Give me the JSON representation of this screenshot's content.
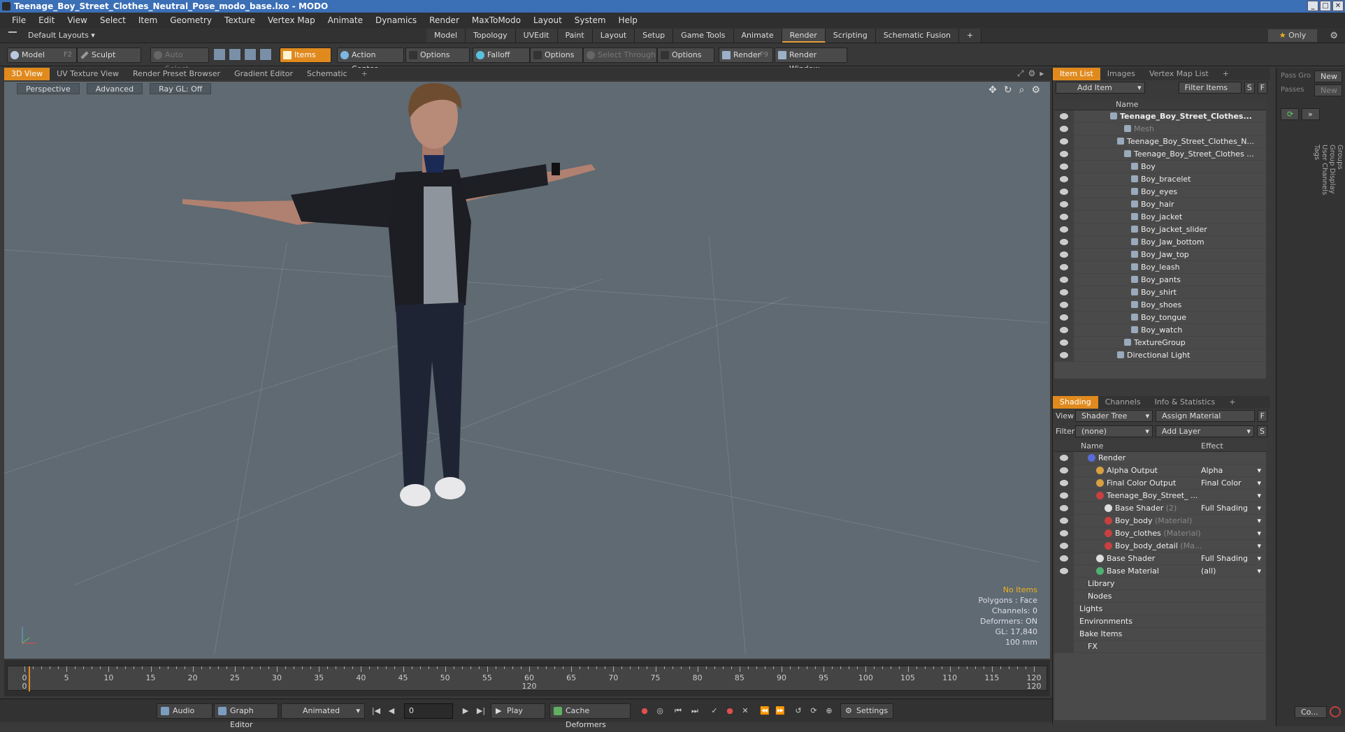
{
  "app": {
    "title": "Teenage_Boy_Street_Clothes_Neutral_Pose_modo_base.lxo - MODO"
  },
  "menu": [
    "File",
    "Edit",
    "View",
    "Select",
    "Item",
    "Geometry",
    "Texture",
    "Vertex Map",
    "Animate",
    "Dynamics",
    "Render",
    "MaxToModo",
    "Layout",
    "System",
    "Help"
  ],
  "layout": {
    "default_layouts": "Default Layouts ▾",
    "tabs": [
      "Model",
      "Topology",
      "UVEdit",
      "Paint",
      "Layout",
      "Setup",
      "Game Tools",
      "Animate",
      "Render",
      "Scripting",
      "Schematic Fusion",
      "+"
    ],
    "active_tab": "Render",
    "only": "Only"
  },
  "toolbar": {
    "model": "Model",
    "model_key": "F2",
    "sculpt": "Sculpt",
    "auto_select": "Auto Select",
    "items": "Items",
    "action_center": "Action Center",
    "options1": "Options",
    "falloff": "Falloff",
    "options2": "Options",
    "select_through": "Select Through",
    "options3": "Options",
    "render": "Render",
    "render_key": "F9",
    "render_window": "Render Window"
  },
  "viewport_tabs": [
    "3D View",
    "UV Texture View",
    "Render Preset Browser",
    "Gradient Editor",
    "Schematic",
    "+"
  ],
  "viewport": {
    "perspective": "Perspective",
    "advanced": "Advanced",
    "ray_gl": "Ray GL: Off",
    "info": {
      "no_items": "No Items",
      "polygons": "Polygons : Face",
      "channels": "Channels: 0",
      "deformers": "Deformers: ON",
      "gl": "GL: 17,840",
      "scale": "100 mm"
    }
  },
  "timeline": {
    "ticks": [
      "0",
      "5",
      "10",
      "15",
      "20",
      "25",
      "30",
      "35",
      "40",
      "45",
      "50",
      "55",
      "60",
      "65",
      "70",
      "75",
      "80",
      "85",
      "90",
      "95",
      "100",
      "105",
      "110",
      "115",
      "120"
    ],
    "start": "0",
    "mid": "120",
    "end": "120"
  },
  "bottombar": {
    "audio": "Audio",
    "graph_editor": "Graph Editor",
    "animated": "Animated",
    "frame": "0",
    "play": "Play",
    "cache_deformers": "Cache Deformers",
    "settings": "Settings"
  },
  "item_list": {
    "tabs": [
      "Item List",
      "Images",
      "Vertex Map List",
      "+"
    ],
    "add_item": "Add Item",
    "filter_items": "Filter Items",
    "s": "S",
    "f": "F",
    "col_name": "Name",
    "rows": [
      {
        "label": "Teenage_Boy_Street_Clothes...",
        "indent": 1,
        "bold": true
      },
      {
        "label": "Mesh",
        "indent": 3,
        "dim": true
      },
      {
        "label": "Teenage_Boy_Street_Clothes_N...",
        "indent": 2
      },
      {
        "label": "Teenage_Boy_Street_Clothes ...",
        "indent": 3
      },
      {
        "label": "Boy",
        "indent": 4
      },
      {
        "label": "Boy_bracelet",
        "indent": 4
      },
      {
        "label": "Boy_eyes",
        "indent": 4
      },
      {
        "label": "Boy_hair",
        "indent": 4
      },
      {
        "label": "Boy_jacket",
        "indent": 4
      },
      {
        "label": "Boy_jacket_slider",
        "indent": 4
      },
      {
        "label": "Boy_Jaw_bottom",
        "indent": 4
      },
      {
        "label": "Boy_Jaw_top",
        "indent": 4
      },
      {
        "label": "Boy_leash",
        "indent": 4
      },
      {
        "label": "Boy_pants",
        "indent": 4
      },
      {
        "label": "Boy_shirt",
        "indent": 4
      },
      {
        "label": "Boy_shoes",
        "indent": 4
      },
      {
        "label": "Boy_tongue",
        "indent": 4
      },
      {
        "label": "Boy_watch",
        "indent": 4
      },
      {
        "label": "TextureGroup",
        "indent": 3
      },
      {
        "label": "Directional Light",
        "indent": 2
      }
    ]
  },
  "shading": {
    "tabs": [
      "Shading",
      "Channels",
      "Info & Statistics",
      "+"
    ],
    "view_label": "View",
    "view_value": "Shader Tree",
    "assign_material": "Assign Material",
    "filter_label": "Filter",
    "filter_value": "(none)",
    "add_layer": "Add Layer",
    "f": "F",
    "s": "S",
    "col_name": "Name",
    "col_effect": "Effect",
    "rows": [
      {
        "label": "Render",
        "indent": 1,
        "color": "#5a6ad8",
        "effect": ""
      },
      {
        "label": "Alpha Output",
        "indent": 2,
        "color": "#d8a040",
        "effect": "Alpha"
      },
      {
        "label": "Final Color Output",
        "indent": 2,
        "color": "#d8a040",
        "effect": "Final Color"
      },
      {
        "label": "Teenage_Boy_Street_ ...",
        "indent": 2,
        "color": "#c84040",
        "effect": " "
      },
      {
        "label": "Base Shader",
        "suffix": "(2)",
        "indent": 3,
        "color": "#dddddd",
        "effect": "Full Shading"
      },
      {
        "label": "Boy_body",
        "suffix": "(Material)",
        "indent": 3,
        "color": "#c84040",
        "effect": " "
      },
      {
        "label": "Boy_clothes",
        "suffix": "(Material)",
        "indent": 3,
        "color": "#c84040",
        "effect": " "
      },
      {
        "label": "Boy_body_detail",
        "suffix": "(Ma...",
        "indent": 3,
        "color": "#c84040",
        "effect": " "
      },
      {
        "label": "Base Shader",
        "indent": 2,
        "color": "#dddddd",
        "effect": "Full Shading"
      },
      {
        "label": "Base Material",
        "indent": 2,
        "color": "#50b070",
        "effect": "(all)"
      },
      {
        "label": "Library",
        "indent": 1,
        "color": "",
        "effect": ""
      },
      {
        "label": "Nodes",
        "indent": 1,
        "color": "",
        "effect": ""
      },
      {
        "label": "Lights",
        "indent": 0,
        "color": "",
        "effect": ""
      },
      {
        "label": "Environments",
        "indent": 0,
        "color": "",
        "effect": ""
      },
      {
        "label": "Bake Items",
        "indent": 0,
        "color": "",
        "effect": ""
      },
      {
        "label": "FX",
        "indent": 1,
        "color": "",
        "effect": ""
      }
    ]
  },
  "far_right": {
    "pass_group": "Pass Gro",
    "new1": "New",
    "passes": "Passes",
    "new2": "New",
    "vtabs": [
      "Groups",
      "Group Display",
      "User Channels",
      "Tags"
    ],
    "co": "Co..."
  }
}
